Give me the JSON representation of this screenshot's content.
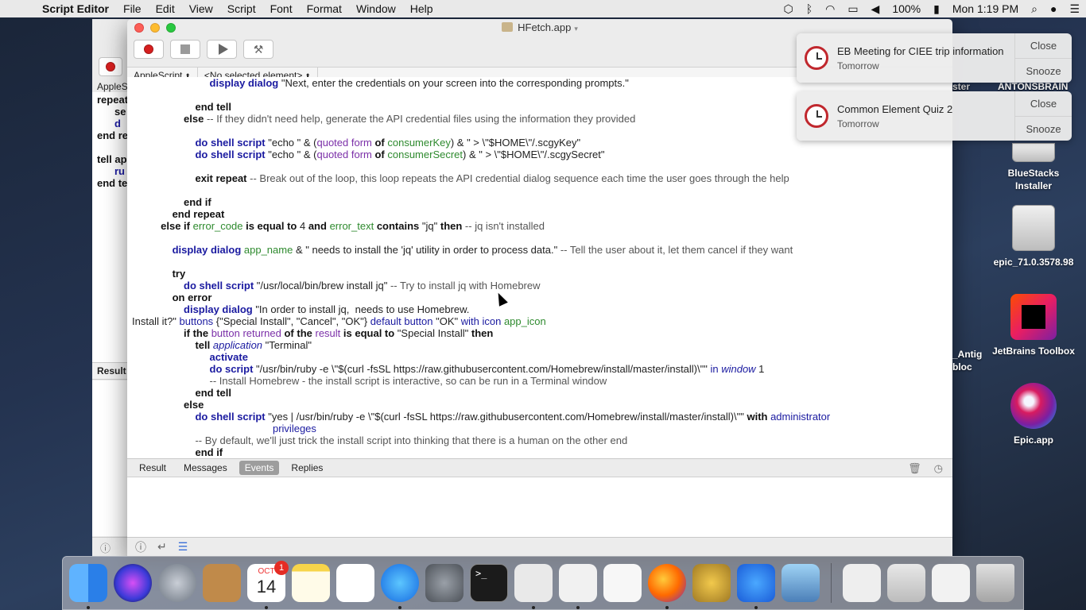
{
  "menubar": {
    "app_name": "Script Editor",
    "items": [
      "File",
      "Edit",
      "View",
      "Script",
      "Font",
      "Format",
      "Window",
      "Help"
    ],
    "battery": "100%",
    "clock": "Mon 1:19 PM"
  },
  "bg_window": {
    "tab_label": "AppleS",
    "code_lines": [
      "repeat",
      "se",
      "d",
      "end re",
      "",
      "tell ap",
      "ru",
      "end te"
    ],
    "result_label": "Result"
  },
  "window": {
    "title": "HFetch.app",
    "language_select": "AppleScript",
    "element_select": "<No selected element>"
  },
  "tabs": [
    "Result",
    "Messages",
    "Events",
    "Replies"
  ],
  "active_tab": "Events",
  "notifications": [
    {
      "title": "EB Meeting for CIEE trip information",
      "subtitle": "Tomorrow",
      "close": "Close",
      "snooze": "Snooze"
    },
    {
      "title": "Common Element Quiz 2",
      "subtitle": "Tomorrow",
      "close": "Close",
      "snooze": "Snooze"
    }
  ],
  "desktop": {
    "partial_top": "ster",
    "partial_top2": "ANTONSBRAIN",
    "partial_mid": "_Antig",
    "partial_mid2": "bloc",
    "icons": [
      {
        "label": "BlueStacks Installer"
      },
      {
        "label": "epic_71.0.3578.98"
      },
      {
        "label": "JetBrains Toolbox"
      },
      {
        "label": "Epic.app"
      }
    ]
  },
  "dock": {
    "calendar_month": "OCT",
    "calendar_day": "14",
    "calendar_badge": "1"
  },
  "code": [
    [
      [
        "t",
        "                           "
      ],
      [
        "bl",
        "display dialog"
      ],
      [
        "t",
        " \"Next, enter the credentials on your screen into the corresponding prompts.\""
      ]
    ],
    [
      [
        "t",
        ""
      ]
    ],
    [
      [
        "t",
        "                      "
      ],
      [
        "kw",
        "end tell"
      ]
    ],
    [
      [
        "t",
        "                  "
      ],
      [
        "kw",
        "else"
      ],
      [
        "cm",
        " -- If they didn't need help, generate the API credential files using the information they provided"
      ]
    ],
    [
      [
        "t",
        ""
      ]
    ],
    [
      [
        "t",
        "                      "
      ],
      [
        "bl",
        "do shell script"
      ],
      [
        "t",
        " \"echo \" & ("
      ],
      [
        "pu",
        "quoted form"
      ],
      [
        "kw",
        " of "
      ],
      [
        "gr",
        "consumerKey"
      ],
      [
        "t",
        ") & \" > \\\"$HOME\\\"/.scgyKey\""
      ]
    ],
    [
      [
        "t",
        "                      "
      ],
      [
        "bl",
        "do shell script"
      ],
      [
        "t",
        " \"echo \" & ("
      ],
      [
        "pu",
        "quoted form"
      ],
      [
        "kw",
        " of "
      ],
      [
        "gr",
        "consumerSecret"
      ],
      [
        "t",
        ") & \" > \\\"$HOME\\\"/.scgySecret\""
      ]
    ],
    [
      [
        "t",
        ""
      ]
    ],
    [
      [
        "t",
        "                      "
      ],
      [
        "kw",
        "exit repeat"
      ],
      [
        "cm",
        " -- Break out of the loop, this loop repeats the API credential dialog sequence each time the user goes through the help"
      ]
    ],
    [
      [
        "t",
        ""
      ]
    ],
    [
      [
        "t",
        "                  "
      ],
      [
        "kw",
        "end if"
      ]
    ],
    [
      [
        "t",
        "              "
      ],
      [
        "kw",
        "end repeat"
      ]
    ],
    [
      [
        "t",
        "          "
      ],
      [
        "kw",
        "else if "
      ],
      [
        "gr",
        "error_code"
      ],
      [
        "kw",
        " is equal to "
      ],
      [
        "t",
        "4"
      ],
      [
        "kw",
        " and "
      ],
      [
        "gr",
        "error_text"
      ],
      [
        "kw",
        " contains "
      ],
      [
        "t",
        "\"jq\" "
      ],
      [
        "kw",
        "then"
      ],
      [
        "cm",
        " -- jq isn't installed"
      ]
    ],
    [
      [
        "t",
        ""
      ]
    ],
    [
      [
        "t",
        "              "
      ],
      [
        "bl",
        "display dialog"
      ],
      [
        "t",
        " "
      ],
      [
        "gr",
        "app_name"
      ],
      [
        "t",
        " & \" needs to install the 'jq' utility in order to process data.\""
      ],
      [
        "cm",
        " -- Tell the user about it, let them cancel if they want"
      ]
    ],
    [
      [
        "t",
        ""
      ]
    ],
    [
      [
        "t",
        "              "
      ],
      [
        "kw",
        "try"
      ]
    ],
    [
      [
        "t",
        "                  "
      ],
      [
        "bl",
        "do shell script"
      ],
      [
        "t",
        " \"/usr/local/bin/brew install jq\""
      ],
      [
        "cm",
        " -- Try to install jq with Homebrew"
      ]
    ],
    [
      [
        "t",
        "              "
      ],
      [
        "kw",
        "on error"
      ]
    ],
    [
      [
        "t",
        "                  "
      ],
      [
        "bl",
        "display dialog"
      ],
      [
        "t",
        " \"In order to install jq,  needs to use Homebrew."
      ]
    ],
    [
      [
        "t",
        "Install it?\" "
      ],
      [
        "vb",
        "buttons"
      ],
      [
        "t",
        " {\"Special Install\", \"Cancel\", \"OK\"} "
      ],
      [
        "vb",
        "default button"
      ],
      [
        "t",
        " \"OK\" "
      ],
      [
        "vb",
        "with icon"
      ],
      [
        "t",
        " "
      ],
      [
        "gr",
        "app_icon"
      ]
    ],
    [
      [
        "t",
        "                  "
      ],
      [
        "kw",
        "if the "
      ],
      [
        "pu",
        "button returned"
      ],
      [
        "kw",
        " of the "
      ],
      [
        "pu",
        "result"
      ],
      [
        "kw",
        " is equal to "
      ],
      [
        "t",
        "\"Special Install\" "
      ],
      [
        "kw",
        "then"
      ]
    ],
    [
      [
        "t",
        "                      "
      ],
      [
        "kw",
        "tell "
      ],
      [
        "it",
        "application"
      ],
      [
        "t",
        " \"Terminal\""
      ]
    ],
    [
      [
        "t",
        "                           "
      ],
      [
        "bl",
        "activate"
      ]
    ],
    [
      [
        "t",
        "                           "
      ],
      [
        "bl",
        "do script"
      ],
      [
        "t",
        " \"/usr/bin/ruby -e \\\"$(curl -fsSL https://raw.githubusercontent.com/Homebrew/install/master/install)\\\"\" "
      ],
      [
        "vb",
        "in "
      ],
      [
        "it",
        "window"
      ],
      [
        "t",
        " 1"
      ]
    ],
    [
      [
        "t",
        "                           "
      ],
      [
        "cm",
        "-- Install Homebrew - the install script is interactive, so can be run in a Terminal window"
      ]
    ],
    [
      [
        "t",
        "                      "
      ],
      [
        "kw",
        "end tell"
      ]
    ],
    [
      [
        "t",
        "                  "
      ],
      [
        "kw",
        "else"
      ]
    ],
    [
      [
        "t",
        "                      "
      ],
      [
        "bl",
        "do shell script"
      ],
      [
        "t",
        " \"yes | /usr/bin/ruby -e \\\"$(curl -fsSL https://raw.githubusercontent.com/Homebrew/install/master/install)\\\"\" "
      ],
      [
        "kw",
        "with "
      ],
      [
        "vb",
        "administrator"
      ]
    ],
    [
      [
        "t",
        "                                                 "
      ],
      [
        "vb",
        "privileges"
      ]
    ],
    [
      [
        "t",
        "                      "
      ],
      [
        "cm",
        "-- By default, we'll just trick the install script into thinking that there is a human on the other end"
      ]
    ],
    [
      [
        "t",
        "                      "
      ],
      [
        "kw",
        "end if"
      ]
    ]
  ]
}
